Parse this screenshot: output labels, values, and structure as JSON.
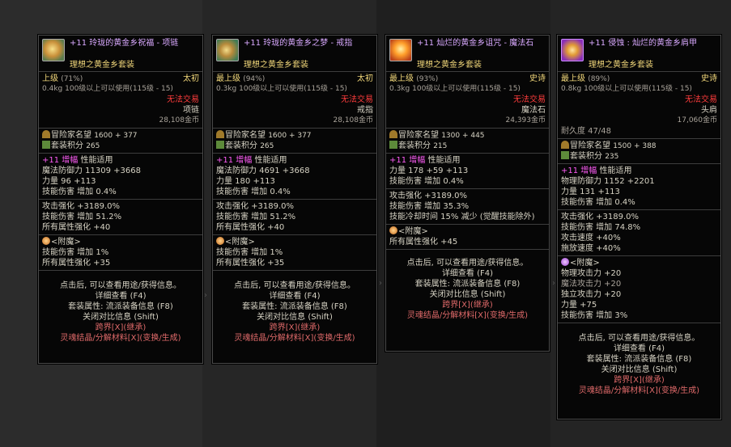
{
  "common": {
    "adventurer_label": "冒险家名望",
    "set_score_label": "套装积分",
    "amplify_prefix": "+11",
    "amplify_label": "增幅",
    "perf_label": "性能适用",
    "enchant_label": "附魔",
    "footer": {
      "hint": "点击后, 可以查看用途/获得信息。",
      "detail": "详细查看 (F4)",
      "set_info": "套装属性: 流派装备信息 (F8)",
      "close_compare": "关闭对比信息 (Shift)",
      "transfer": "跨界[X](继承)",
      "soul": "灵魂结晶/分解材料[X](变换/生成)"
    },
    "icons": {
      "adventurer": "crest-icon",
      "set": "set-pieces-icon",
      "enchant": "orb-icon"
    }
  },
  "cards": [
    {
      "title": "+11 玲珑的黄金乡祝福 - 项链",
      "set": "理想之黄金乡套装",
      "rank": "上级",
      "rank_pct": "(71%)",
      "rarity": "太初",
      "weight": "0.4kg",
      "use": "100级以上可以使用(115级 - 15)",
      "trade": "无法交易",
      "type": "项链",
      "price": "28,108金币",
      "fame": "1600 + 377",
      "set_score": "265",
      "amp_stat": "魔法防御力 11309 +3668",
      "str": "力量 96 +113",
      "skill_dmg": "技能伤害 增加 0.4%",
      "attack": "攻击强化 +3189.0%",
      "skill_dmg2": "技能伤害 增加 51.2%",
      "all_attr": "所有属性强化 +40",
      "enchant_lines": [
        "技能伤害 增加 1%",
        "所有属性强化 +35"
      ]
    },
    {
      "title": "+11 玲珑的黄金乡之梦 - 戒指",
      "set": "理想之黄金乡套装",
      "rank": "最上级",
      "rank_pct": "(94%)",
      "rarity": "太初",
      "weight": "0.3kg",
      "use": "100级以上可以使用(115级 - 15)",
      "trade": "无法交易",
      "type": "戒指",
      "price": "28,108金币",
      "fame": "1600 + 377",
      "set_score": "265",
      "amp_stat": "魔法防御力 4691 +3668",
      "str": "力量 180 +113",
      "skill_dmg": "技能伤害 增加 0.4%",
      "attack": "攻击强化 +3189.0%",
      "skill_dmg2": "技能伤害 增加 51.2%",
      "all_attr": "所有属性强化 +40",
      "enchant_lines": [
        "技能伤害 增加 1%",
        "所有属性强化 +35"
      ]
    },
    {
      "title": "+11 灿烂的黄金乡诅咒 - 魔法石",
      "set": "理想之黄金乡套装",
      "rank": "最上级",
      "rank_pct": "(93%)",
      "rarity": "史诗",
      "weight": "0.3kg",
      "use": "100级以上可以使用(115级 - 15)",
      "trade": "无法交易",
      "type": "魔法石",
      "price": "24,393金币",
      "fame": "1300 + 445",
      "set_score": "215",
      "str": "力量 178 +59 +113",
      "skill_dmg": "技能伤害 增加 0.4%",
      "attack": "攻击强化 +3189.0%",
      "skill_dmg2": "技能伤害 增加 35.3%",
      "cooldown": "技能冷却时间 15% 减少 (觉醒技能除外)",
      "enchant_lines": [
        "所有属性强化 +45"
      ]
    },
    {
      "title": "+11 侵蚀 : 灿烂的黄金乡肩甲",
      "set": "理想之黄金乡套装",
      "rank": "最上级",
      "rank_pct": "(89%)",
      "rarity": "史诗",
      "weight": "0.8kg",
      "use": "100级以上可以使用(115级 - 15)",
      "trade": "无法交易",
      "type": "头肩",
      "price": "17,060金币",
      "durability": "耐久度 47/48",
      "fame": "1500 + 388",
      "set_score": "235",
      "amp_stat": "物理防御力 1152 +2201",
      "str": "力量 131 +113",
      "skill_dmg": "技能伤害 增加 0.4%",
      "attack": "攻击强化 +3189.0%",
      "skill_dmg2": "技能伤害 增加 74.8%",
      "atk_speed": "攻击速度 +40%",
      "cast_speed": "施放速度 +40%",
      "enchant_lines": [
        "物理攻击力 +20",
        "魔法攻击力 +20",
        "独立攻击力 +20",
        "力量 +75",
        "技能伤害 增加 3%"
      ]
    }
  ]
}
